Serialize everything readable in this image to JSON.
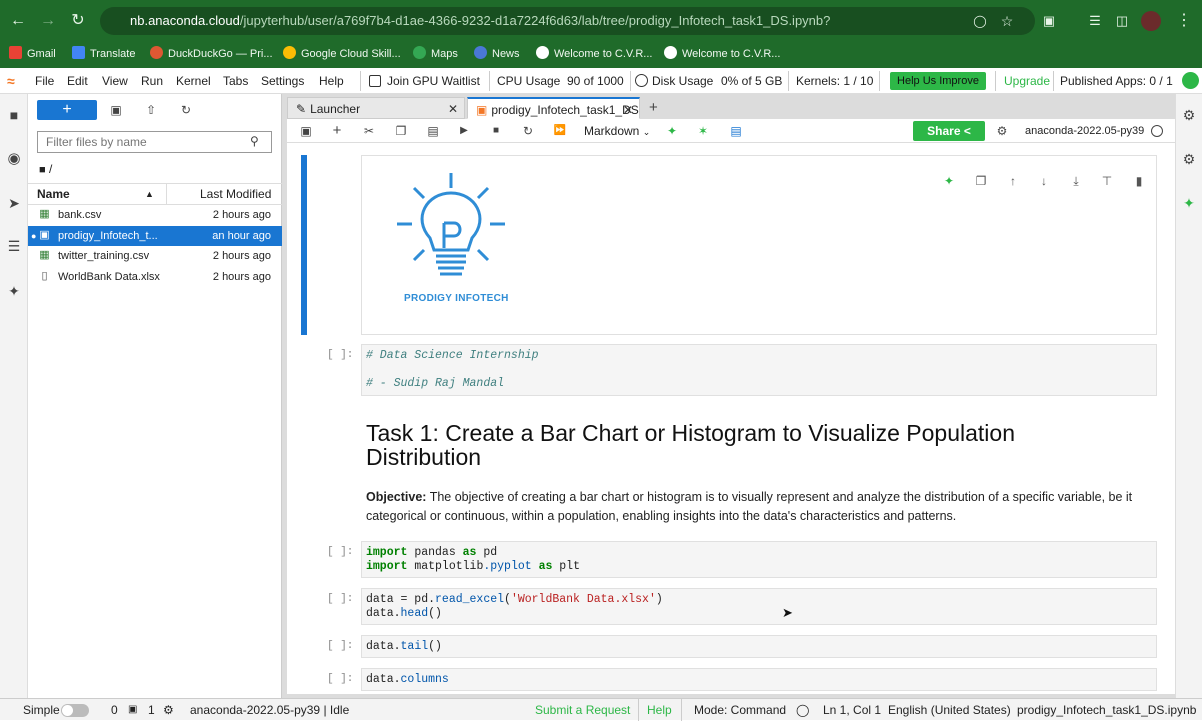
{
  "browser": {
    "url_host": "nb.anaconda.cloud",
    "url_path": "/jupyterhub/user/a769f7b4-d1ae-4366-9232-d1a7224f6d63/lab/tree/prodigy_Infotech_task1_DS.ipynb?",
    "bookmarks": [
      "Gmail",
      "Translate",
      "DuckDuckGo — Pri...",
      "Google Cloud Skill...",
      "Maps",
      "News",
      "Welcome to C.V.R...",
      "Welcome to C.V.R..."
    ]
  },
  "menubar": {
    "items": [
      "File",
      "Edit",
      "View",
      "Run",
      "Kernel",
      "Tabs",
      "Settings",
      "Help"
    ],
    "gpu_waitlist": "Join GPU Waitlist",
    "cpu_label": "CPU Usage",
    "cpu_value": "90 of 1000",
    "disk_label": "Disk Usage",
    "disk_value": "0% of 5 GB",
    "kernels": "Kernels: 1 / 10",
    "help_improve": "Help Us Improve",
    "upgrade": "Upgrade",
    "published_apps": "Published Apps: 0 / 1"
  },
  "filebrowser": {
    "filter_placeholder": "Filter files by name",
    "breadcrumb": "/",
    "col_name": "Name",
    "col_modified": "Last Modified",
    "files": [
      {
        "name": "bank.csv",
        "modified": "2 hours ago"
      },
      {
        "name": "prodigy_Infotech_t...",
        "modified": "an hour ago"
      },
      {
        "name": "twitter_training.csv",
        "modified": "2 hours ago"
      },
      {
        "name": "WorldBank Data.xlsx",
        "modified": "2 hours ago"
      }
    ]
  },
  "tabs": [
    "Launcher",
    "prodigy_Infotech_task1_DS"
  ],
  "notebook_toolbar": {
    "cell_type": "Markdown",
    "share": "Share",
    "kernel_name": "anaconda-2022.05-py39"
  },
  "cells": {
    "logo_text": "PRODIGY INFOTECH",
    "prompt": "[ ]:",
    "comment1": "# Data Science Internship",
    "comment2": "# - Sudip Raj Mandal",
    "heading": "Task 1: Create a Bar Chart or Histogram to Visualize Population Distribution",
    "objective_label": "Objective:",
    "objective_text": "The objective of creating a bar chart or histogram is to visually represent and analyze the distribution of a specific variable, be it categorical or continuous, within a population, enabling insights into the data's characteristics and patterns.",
    "import1_kw": "import",
    "import1_mod": "pandas",
    "import1_as": "as",
    "import1_alias": "pd",
    "import2_kw": "import",
    "import2_mod_a": "matplotlib",
    "import2_mod_b": ".pyplot",
    "import2_as": "as",
    "import2_alias": "plt",
    "read_var": "data = pd.",
    "read_fn": "read_excel",
    "read_arg": "'WorldBank Data.xlsx'",
    "head_var": "data.",
    "head_fn": "head",
    "tail_var": "data.",
    "tail_fn": "tail",
    "cols_var": "data.",
    "cols_attr": "columns"
  },
  "statusbar": {
    "mode_simple": "Simple",
    "terminals": "0",
    "kernels": "1",
    "kernel_status": "anaconda-2022.05-py39 | Idle",
    "submit_request": "Submit a Request",
    "help": "Help",
    "mode": "Mode: Command",
    "cursor": "Ln 1, Col 1",
    "language": "English (United States)",
    "filename": "prodigy_Infotech_task1_DS.ipynb"
  },
  "colors": {
    "accent": "#1976d2",
    "green": "#2db747",
    "chrome": "#1f6b2a"
  }
}
